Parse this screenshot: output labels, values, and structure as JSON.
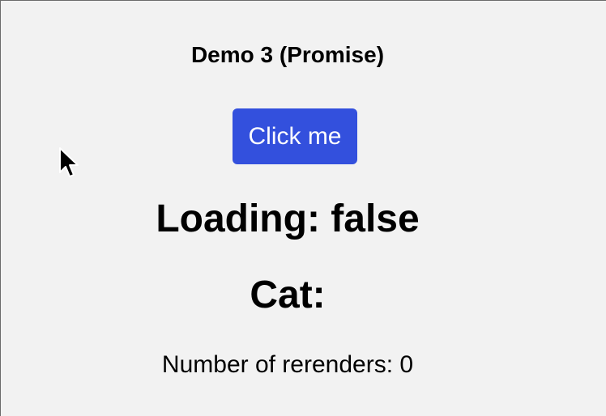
{
  "demo": {
    "title": "Demo 3 (Promise)",
    "button_label": "Click me",
    "loading_text": "Loading: false",
    "cat_text": "Cat:",
    "rerenders_text": "Number of rerenders: 0"
  },
  "colors": {
    "background": "#f2f2f2",
    "button": "#3350dd",
    "button_text": "#ffffff"
  },
  "icons": {
    "cursor": "mouse-pointer-icon"
  }
}
